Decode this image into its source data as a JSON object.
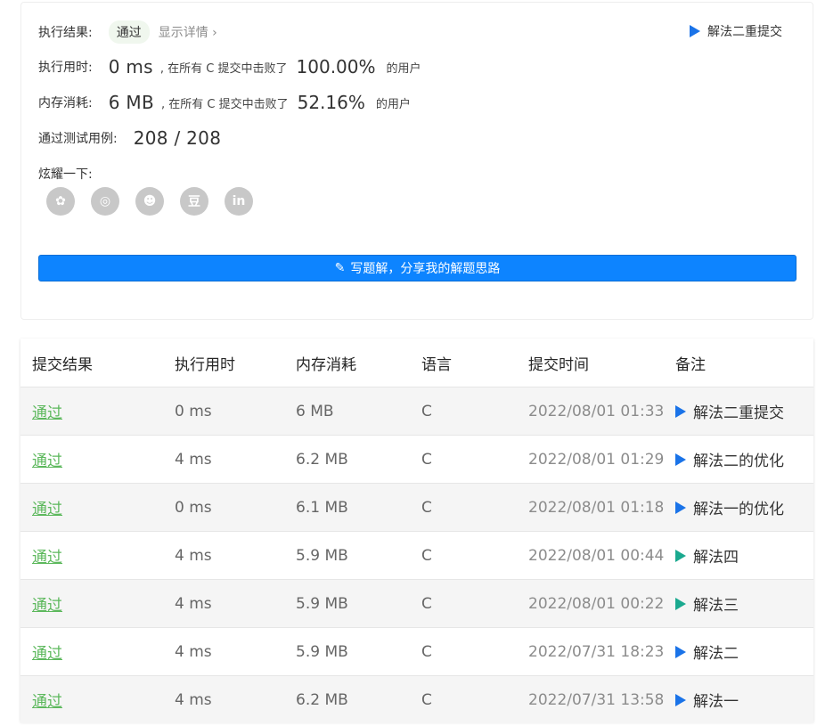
{
  "summary": {
    "result_label": "执行结果:",
    "result_badge": "通过",
    "show_detail": "显示详情 ›",
    "top_submission": "解法二重提交",
    "time_label": "执行用时:",
    "time_value": "0 ms",
    "time_mid": ", 在所有 C 提交中击败了",
    "time_pct": "100.00%",
    "time_suffix": "的用户",
    "mem_label": "内存消耗:",
    "mem_value": "6 MB",
    "mem_mid": ", 在所有 C 提交中击败了",
    "mem_pct": "52.16%",
    "mem_suffix": "的用户",
    "tests_label": "通过测试用例:",
    "tests_value": "208 / 208",
    "share_label": "炫耀一下:",
    "share_icons": [
      {
        "name": "wechat-icon",
        "glyph": "✿"
      },
      {
        "name": "weibo-icon",
        "glyph": "◎"
      },
      {
        "name": "qq-icon",
        "glyph": "☻"
      },
      {
        "name": "douban-icon",
        "glyph": "豆"
      },
      {
        "name": "linkedin-icon",
        "glyph": "in"
      }
    ],
    "write_button": "写题解，分享我的解题思路"
  },
  "table": {
    "headers": [
      "提交结果",
      "执行用时",
      "内存消耗",
      "语言",
      "提交时间",
      "备注"
    ],
    "rows": [
      {
        "status": "通过",
        "time": "0 ms",
        "memory": "6 MB",
        "lang": "C",
        "submitted": "2022/08/01 01:33",
        "note": "解法二重提交",
        "flag": "blue"
      },
      {
        "status": "通过",
        "time": "4 ms",
        "memory": "6.2 MB",
        "lang": "C",
        "submitted": "2022/08/01 01:29",
        "note": "解法二的优化",
        "flag": "blue"
      },
      {
        "status": "通过",
        "time": "0 ms",
        "memory": "6.1 MB",
        "lang": "C",
        "submitted": "2022/08/01 01:18",
        "note": "解法一的优化",
        "flag": "blue"
      },
      {
        "status": "通过",
        "time": "4 ms",
        "memory": "5.9 MB",
        "lang": "C",
        "submitted": "2022/08/01 00:44",
        "note": "解法四",
        "flag": "teal"
      },
      {
        "status": "通过",
        "time": "4 ms",
        "memory": "5.9 MB",
        "lang": "C",
        "submitted": "2022/08/01 00:22",
        "note": "解法三",
        "flag": "teal"
      },
      {
        "status": "通过",
        "time": "4 ms",
        "memory": "5.9 MB",
        "lang": "C",
        "submitted": "2022/07/31 18:23",
        "note": "解法二",
        "flag": "blue"
      },
      {
        "status": "通过",
        "time": "4 ms",
        "memory": "6.2 MB",
        "lang": "C",
        "submitted": "2022/07/31 13:58",
        "note": "解法一",
        "flag": "blue"
      }
    ]
  }
}
